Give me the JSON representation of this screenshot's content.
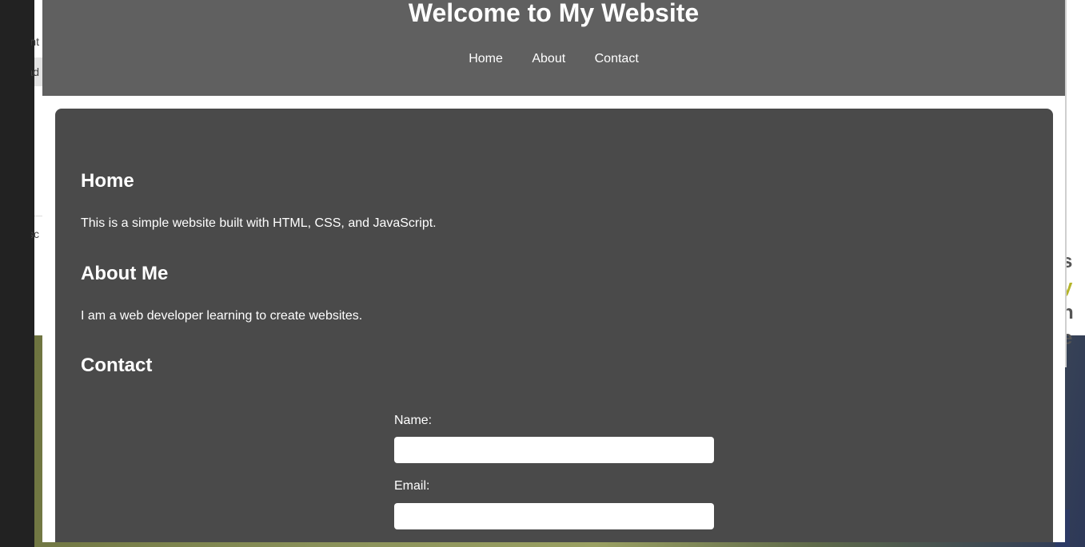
{
  "background_page": {
    "fragments": [
      "nt",
      "ad",
      "sc"
    ],
    "right_text": [
      "s",
      "y",
      "n",
      "e"
    ],
    "accent_color": "#b5b52a"
  },
  "site": {
    "title": "Welcome to My Website",
    "nav": [
      {
        "label": "Home"
      },
      {
        "label": "About"
      },
      {
        "label": "Contact"
      }
    ]
  },
  "sections": {
    "home": {
      "heading": "Home",
      "text": "This is a simple website built with HTML, CSS, and JavaScript."
    },
    "about": {
      "heading": "About Me",
      "text": "I am a web developer learning to create websites."
    },
    "contact": {
      "heading": "Contact",
      "form": {
        "name_label": "Name:",
        "name_value": "",
        "email_label": "Email:",
        "email_value": ""
      }
    }
  },
  "colors": {
    "header_bg": "#606060",
    "content_bg": "#4a4a4a",
    "text": "#ffffff"
  }
}
